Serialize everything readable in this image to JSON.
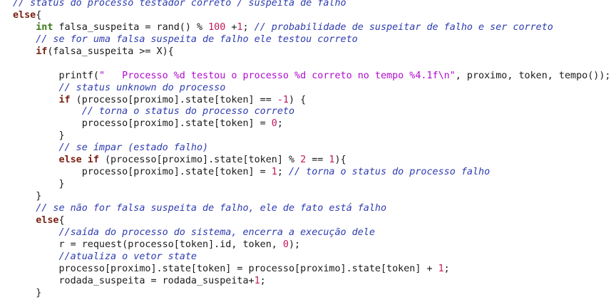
{
  "colors": {
    "background": "#ffffff",
    "text": "#1a1a1a",
    "comment": "#2d3bb0",
    "keyword": "#7a1f12",
    "type": "#3b7a1a",
    "number": "#c2185b",
    "string": "#b00bd0"
  },
  "lines": [
    [
      {
        "t": "// status do processo testador correto / suspeita de falho",
        "c": "comment"
      }
    ],
    [
      {
        "t": "else",
        "c": "kw"
      },
      {
        "t": "{",
        "c": "plain"
      }
    ],
    [
      {
        "t": "    ",
        "c": "plain"
      },
      {
        "t": "int",
        "c": "type"
      },
      {
        "t": " falsa_suspeita = rand() % ",
        "c": "plain"
      },
      {
        "t": "100",
        "c": "num"
      },
      {
        "t": " +",
        "c": "plain"
      },
      {
        "t": "1",
        "c": "num"
      },
      {
        "t": "; ",
        "c": "plain"
      },
      {
        "t": "// probabilidade de suspeitar de falho e ser correto",
        "c": "comment"
      }
    ],
    [
      {
        "t": "    ",
        "c": "plain"
      },
      {
        "t": "// se for uma falsa suspeita de falho ele testou correto",
        "c": "comment"
      }
    ],
    [
      {
        "t": "    ",
        "c": "plain"
      },
      {
        "t": "if",
        "c": "kw"
      },
      {
        "t": "(falsa_suspeita >= X){",
        "c": "plain"
      }
    ],
    [
      {
        "t": "",
        "c": "plain"
      }
    ],
    [
      {
        "t": "        printf(",
        "c": "plain"
      },
      {
        "t": "\"   Processo %d testou o processo %d correto no tempo %4.1f\\n\"",
        "c": "str"
      },
      {
        "t": ", proximo, token, tempo());",
        "c": "plain"
      }
    ],
    [
      {
        "t": "        ",
        "c": "plain"
      },
      {
        "t": "// status unknown do processo",
        "c": "comment"
      }
    ],
    [
      {
        "t": "        ",
        "c": "plain"
      },
      {
        "t": "if",
        "c": "kw"
      },
      {
        "t": " (processo[proximo].state[token] == ",
        "c": "plain"
      },
      {
        "t": "-1",
        "c": "num"
      },
      {
        "t": ") {",
        "c": "plain"
      }
    ],
    [
      {
        "t": "            ",
        "c": "plain"
      },
      {
        "t": "// torna o status do processo correto",
        "c": "comment"
      }
    ],
    [
      {
        "t": "            processo[proximo].state[token] = ",
        "c": "plain"
      },
      {
        "t": "0",
        "c": "num"
      },
      {
        "t": ";",
        "c": "plain"
      }
    ],
    [
      {
        "t": "        }",
        "c": "plain"
      }
    ],
    [
      {
        "t": "        ",
        "c": "plain"
      },
      {
        "t": "// se ímpar (estado falho)",
        "c": "comment"
      }
    ],
    [
      {
        "t": "        ",
        "c": "plain"
      },
      {
        "t": "else if",
        "c": "kw"
      },
      {
        "t": " (processo[proximo].state[token] % ",
        "c": "plain"
      },
      {
        "t": "2",
        "c": "num"
      },
      {
        "t": " == ",
        "c": "plain"
      },
      {
        "t": "1",
        "c": "num"
      },
      {
        "t": "){",
        "c": "plain"
      }
    ],
    [
      {
        "t": "            processo[proximo].state[token] = ",
        "c": "plain"
      },
      {
        "t": "1",
        "c": "num"
      },
      {
        "t": "; ",
        "c": "plain"
      },
      {
        "t": "// torna o status do processo falho",
        "c": "comment"
      }
    ],
    [
      {
        "t": "        }",
        "c": "plain"
      }
    ],
    [
      {
        "t": "    }",
        "c": "plain"
      }
    ],
    [
      {
        "t": "    ",
        "c": "plain"
      },
      {
        "t": "// se não for falsa suspeita de falho, ele de fato está falho",
        "c": "comment"
      }
    ],
    [
      {
        "t": "    ",
        "c": "plain"
      },
      {
        "t": "else",
        "c": "kw"
      },
      {
        "t": "{",
        "c": "plain"
      }
    ],
    [
      {
        "t": "        ",
        "c": "plain"
      },
      {
        "t": "//saída do processo do sistema, encerra a execução dele",
        "c": "comment"
      }
    ],
    [
      {
        "t": "        r = request(processo[token].id, token, ",
        "c": "plain"
      },
      {
        "t": "0",
        "c": "num"
      },
      {
        "t": ");",
        "c": "plain"
      }
    ],
    [
      {
        "t": "        ",
        "c": "plain"
      },
      {
        "t": "//atualiza o vetor state",
        "c": "comment"
      }
    ],
    [
      {
        "t": "        processo[proximo].state[token] = processo[proximo].state[token] + ",
        "c": "plain"
      },
      {
        "t": "1",
        "c": "num"
      },
      {
        "t": ";",
        "c": "plain"
      }
    ],
    [
      {
        "t": "        rodada_suspeita = rodada_suspeita+",
        "c": "plain"
      },
      {
        "t": "1",
        "c": "num"
      },
      {
        "t": ";",
        "c": "plain"
      }
    ],
    [
      {
        "t": "    }",
        "c": "plain"
      }
    ]
  ]
}
